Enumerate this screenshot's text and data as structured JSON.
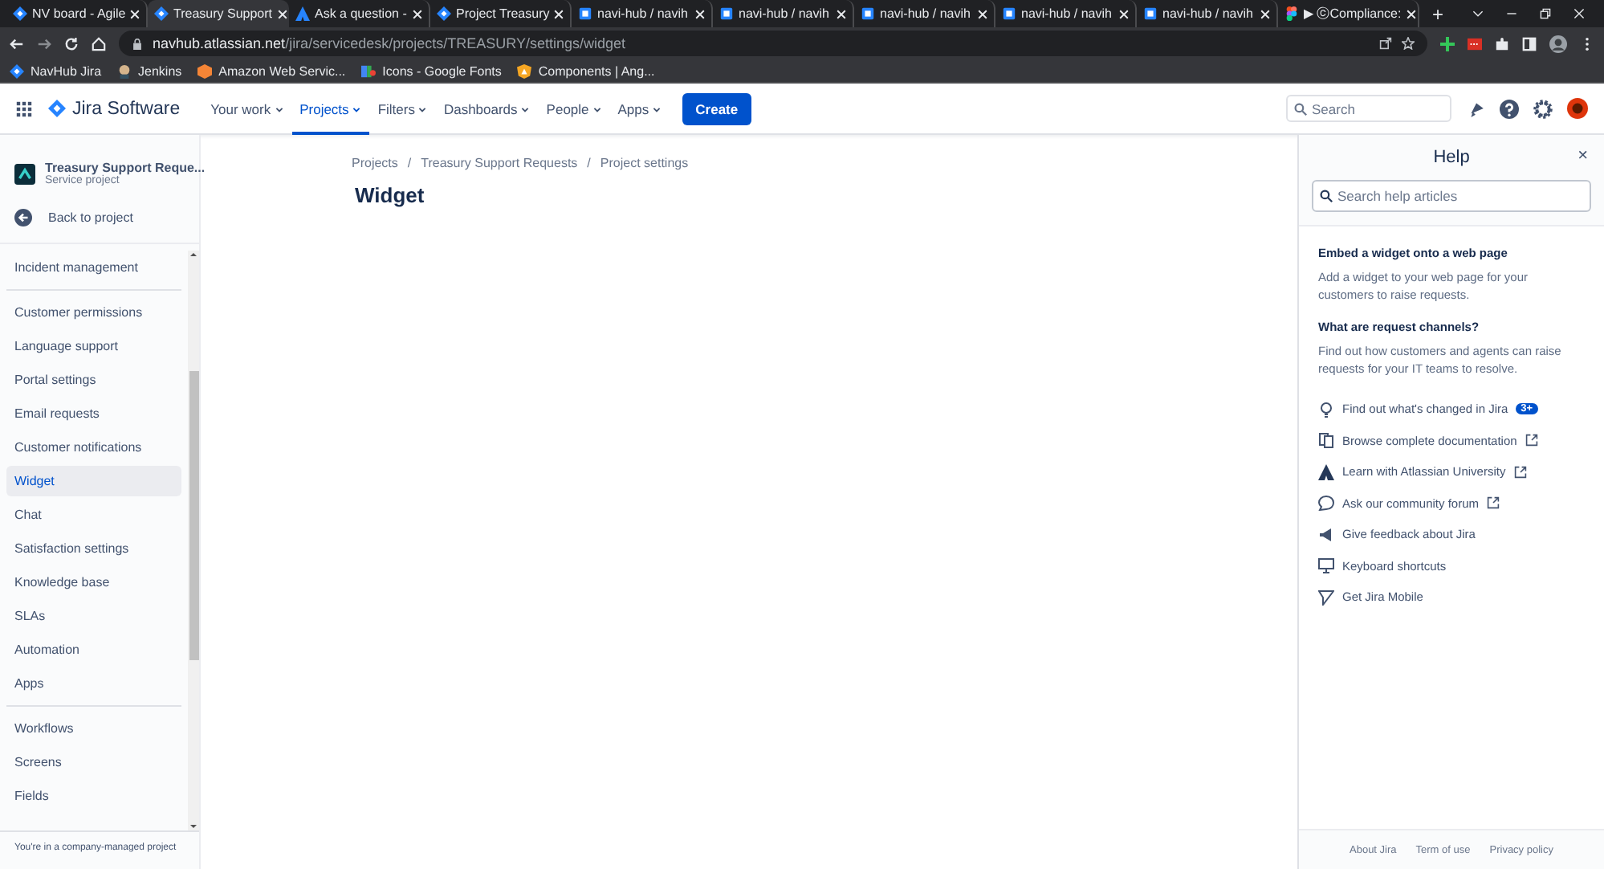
{
  "browser": {
    "tabs": [
      {
        "kind": "jira",
        "title": "NV board - Agile",
        "selected": false
      },
      {
        "kind": "jira",
        "title": "Treasury Support",
        "selected": true
      },
      {
        "kind": "atlassian",
        "title": "Ask a question -",
        "selected": false
      },
      {
        "kind": "jira",
        "title": "Project Treasury",
        "selected": false
      },
      {
        "kind": "bitbucket",
        "title": "navi-hub / navih",
        "selected": false
      },
      {
        "kind": "bitbucket",
        "title": "navi-hub / navih",
        "selected": false
      },
      {
        "kind": "bitbucket",
        "title": "navi-hub / navih",
        "selected": false
      },
      {
        "kind": "bitbucket",
        "title": "navi-hub / navih",
        "selected": false
      },
      {
        "kind": "bitbucket",
        "title": "navi-hub / navih",
        "selected": false
      },
      {
        "kind": "figma",
        "title": "▶ ⓒCompliance:",
        "selected": false
      }
    ],
    "new_tab": "+",
    "url": {
      "host": "navhub.atlassian.net",
      "path": "/jira/servicedesk/projects/TREASURY/settings/widget"
    },
    "bookmarks": [
      {
        "kind": "jira",
        "label": "NavHub Jira"
      },
      {
        "kind": "jenkins",
        "label": "Jenkins"
      },
      {
        "kind": "aws",
        "label": "Amazon Web Servic..."
      },
      {
        "kind": "fonts",
        "label": "Icons - Google Fonts"
      },
      {
        "kind": "angular",
        "label": "Components | Ang..."
      }
    ]
  },
  "topnav": {
    "product": "Jira Software",
    "menus": [
      {
        "label": "Your work",
        "selected": false
      },
      {
        "label": "Projects",
        "selected": true
      },
      {
        "label": "Filters",
        "selected": false
      },
      {
        "label": "Dashboards",
        "selected": false
      },
      {
        "label": "People",
        "selected": false
      },
      {
        "label": "Apps",
        "selected": false
      }
    ],
    "create": "Create",
    "search": {
      "placeholder": "Search"
    }
  },
  "sidebar": {
    "project": {
      "name": "Treasury Support Reque...",
      "type": "Service project"
    },
    "back": "Back to project",
    "groups": [
      [
        {
          "label": "Incident management",
          "selected": false
        }
      ],
      [
        {
          "label": "Customer permissions",
          "selected": false
        },
        {
          "label": "Language support",
          "selected": false
        },
        {
          "label": "Portal settings",
          "selected": false
        },
        {
          "label": "Email requests",
          "selected": false
        },
        {
          "label": "Customer notifications",
          "selected": false
        },
        {
          "label": "Widget",
          "selected": true
        },
        {
          "label": "Chat",
          "selected": false
        },
        {
          "label": "Satisfaction settings",
          "selected": false
        },
        {
          "label": "Knowledge base",
          "selected": false
        },
        {
          "label": "SLAs",
          "selected": false
        },
        {
          "label": "Automation",
          "selected": false
        },
        {
          "label": "Apps",
          "selected": false
        }
      ],
      [
        {
          "label": "Workflows",
          "selected": false
        },
        {
          "label": "Screens",
          "selected": false
        },
        {
          "label": "Fields",
          "selected": false
        }
      ]
    ],
    "footer": "You're in a company-managed project"
  },
  "main": {
    "breadcrumbs": [
      "Projects",
      "Treasury Support Requests",
      "Project settings"
    ],
    "separator": "/",
    "title": "Widget"
  },
  "help": {
    "title": "Help",
    "close": "×",
    "search": {
      "placeholder": "Search help articles"
    },
    "sections": [
      {
        "heading": "Embed a widget onto a web page",
        "body": "Add a widget to your web page for your customers to raise requests."
      },
      {
        "heading": "What are request channels?",
        "body": "Find out how customers and agents can raise requests for your IT teams to resolve."
      }
    ],
    "links": [
      {
        "kind": "bulb",
        "label": "Find out what's changed in Jira",
        "badge": "3+",
        "external": false
      },
      {
        "kind": "docs",
        "label": "Browse complete documentation",
        "external": true
      },
      {
        "kind": "atlassian",
        "label": "Learn with Atlassian University",
        "external": true
      },
      {
        "kind": "chat",
        "label": "Ask our community forum",
        "external": true
      },
      {
        "kind": "megaphone",
        "label": "Give feedback about Jira",
        "external": false
      },
      {
        "kind": "keyboard",
        "label": "Keyboard shortcuts",
        "external": false
      },
      {
        "kind": "mobile",
        "label": "Get Jira Mobile",
        "external": false
      }
    ],
    "footer": [
      "About Jira",
      "Term of use",
      "Privacy policy"
    ]
  }
}
